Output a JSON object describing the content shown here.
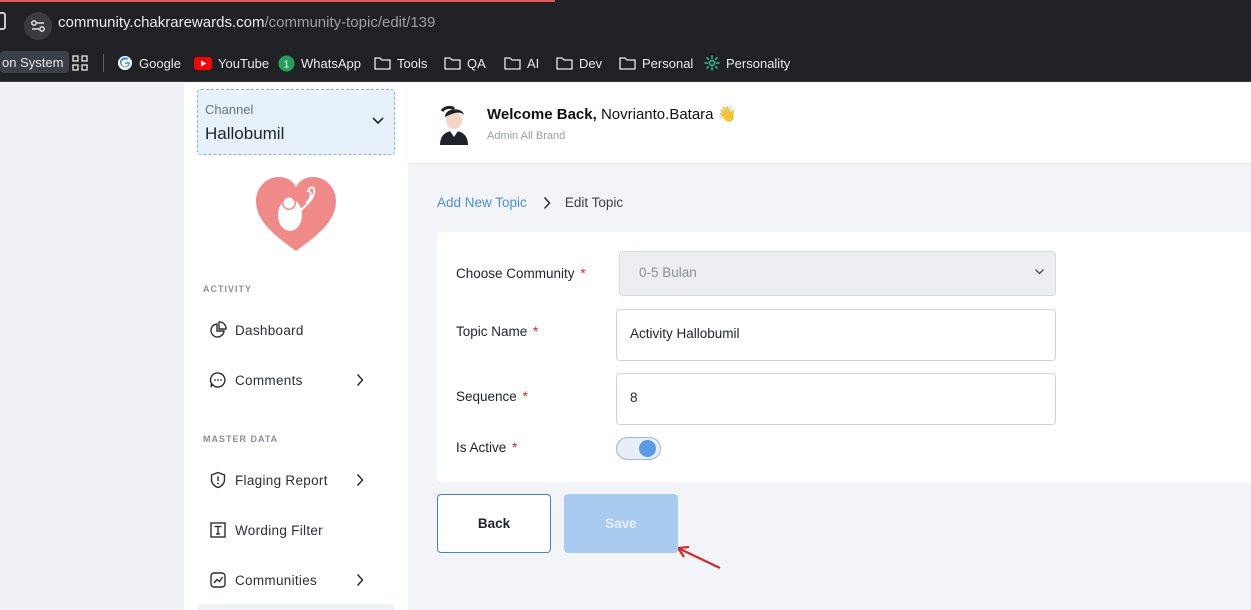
{
  "browser": {
    "url_host": "community.chakrarewards.com",
    "url_path": "/community-topic/edit/139",
    "bookmarks": [
      {
        "label": "on System"
      },
      {
        "label": "Google"
      },
      {
        "label": "YouTube"
      },
      {
        "label": "WhatsApp",
        "badge": "1"
      },
      {
        "label": "Tools"
      },
      {
        "label": "QA"
      },
      {
        "label": "AI"
      },
      {
        "label": "Dev"
      },
      {
        "label": "Personal"
      },
      {
        "label": "Personality"
      }
    ]
  },
  "sidebar": {
    "channel_label": "Channel",
    "channel_value": "Hallobumil",
    "sections": [
      {
        "label": "ACTIVITY"
      },
      {
        "label": "MASTER DATA"
      }
    ],
    "items": [
      {
        "label": "Dashboard"
      },
      {
        "label": "Comments"
      },
      {
        "label": "Flaging Report"
      },
      {
        "label": "Wording Filter"
      },
      {
        "label": "Communities"
      }
    ]
  },
  "header": {
    "welcome_prefix": "Welcome Back,",
    "user_name": "Novrianto.Batara",
    "wave_emoji": "👋",
    "role": "Admin All Brand"
  },
  "breadcrumb": {
    "link": "Add New Topic",
    "current": "Edit Topic"
  },
  "form": {
    "community_label": "Choose Community",
    "community_value": "0-5 Bulan",
    "topic_label": "Topic Name",
    "topic_value": "Activity Hallobumil",
    "sequence_label": "Sequence",
    "sequence_value": "8",
    "active_label": "Is Active",
    "is_active": true,
    "required_mark": "*"
  },
  "buttons": {
    "back": "Back",
    "save": "Save"
  },
  "colors": {
    "accent": "#4a90d9",
    "toggle_knob": "#5b9be6",
    "save_disabled": "#aacbf0",
    "required": "#e02424",
    "logo": "#f08a88"
  }
}
